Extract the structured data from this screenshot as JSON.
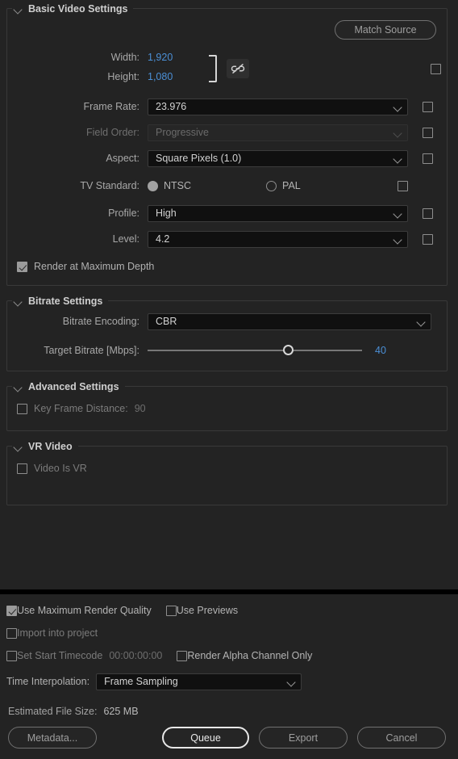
{
  "basic_video": {
    "title": "Basic Video Settings",
    "match_source_label": "Match Source",
    "width_label": "Width:",
    "width_value": "1,920",
    "height_label": "Height:",
    "height_value": "1,080",
    "link_icon_name": "unlinked-chain-icon",
    "frame_rate_label": "Frame Rate:",
    "frame_rate_value": "23.976",
    "field_order_label": "Field Order:",
    "field_order_value": "Progressive",
    "aspect_label": "Aspect:",
    "aspect_value": "Square Pixels (1.0)",
    "tv_standard_label": "TV Standard:",
    "tv_ntsc_label": "NTSC",
    "tv_pal_label": "PAL",
    "tv_selected": "NTSC",
    "profile_label": "Profile:",
    "profile_value": "High",
    "level_label": "Level:",
    "level_value": "4.2",
    "render_max_depth_label": "Render at Maximum Depth",
    "render_max_depth_checked": true
  },
  "bitrate": {
    "title": "Bitrate Settings",
    "encoding_label": "Bitrate Encoding:",
    "encoding_value": "CBR",
    "target_label": "Target Bitrate [Mbps]:",
    "target_value": "40"
  },
  "advanced": {
    "title": "Advanced Settings",
    "key_frame_label": "Key Frame Distance:",
    "key_frame_value": "90",
    "key_frame_checked": false
  },
  "vr": {
    "title": "VR Video",
    "video_is_vr_label": "Video Is VR",
    "video_is_vr_checked": false
  },
  "footer": {
    "use_max_render_quality_label": "Use Maximum Render Quality",
    "use_max_render_quality_checked": true,
    "use_previews_label": "Use Previews",
    "use_previews_checked": false,
    "import_into_project_label": "Import into project",
    "import_into_project_checked": false,
    "set_start_timecode_label": "Set Start Timecode",
    "set_start_timecode_checked": false,
    "timecode_value": "00:00:00:00",
    "render_alpha_label": "Render Alpha Channel Only",
    "render_alpha_checked": false,
    "time_interpolation_label": "Time Interpolation:",
    "time_interpolation_value": "Frame Sampling",
    "estimated_file_size_label": "Estimated File Size:",
    "estimated_file_size_value": "625 MB",
    "metadata_label": "Metadata...",
    "queue_label": "Queue",
    "export_label": "Export",
    "cancel_label": "Cancel"
  },
  "colors": {
    "background": "#232323",
    "accent_blue": "#4b8fd6",
    "panel_border": "#393939",
    "field_background": "#101010"
  }
}
